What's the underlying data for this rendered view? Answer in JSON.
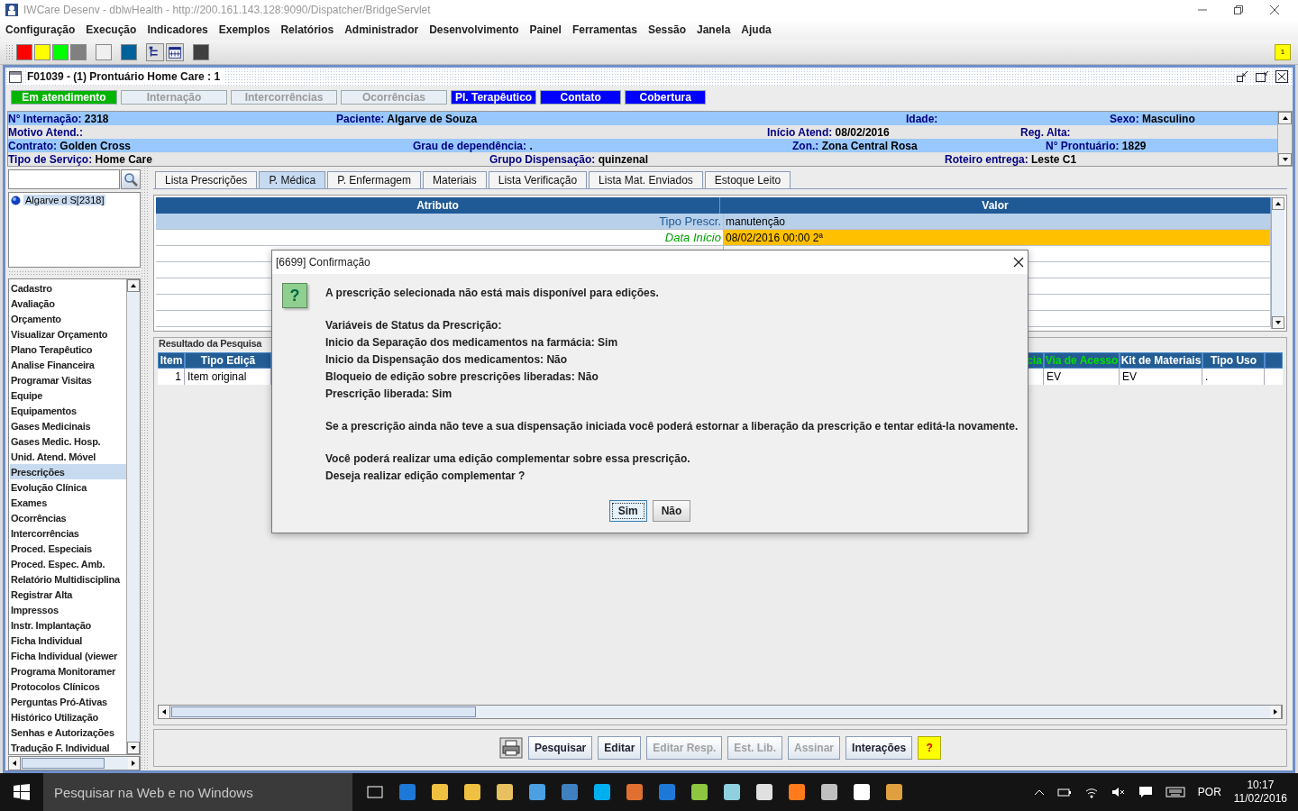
{
  "window": {
    "title": "IWCare Desenv - dblwHealth - http://200.161.143.128:9090/Dispatcher/BridgeServlet"
  },
  "menu": [
    "Configuração",
    "Execução",
    "Indicadores",
    "Exemplos",
    "Relatórios",
    "Administrador",
    "Desenvolvimento",
    "Painel",
    "Ferramentas",
    "Sessão",
    "Janela",
    "Ajuda"
  ],
  "toolbar": {
    "items": [
      {
        "kind": "swatch",
        "color": "#ff0000"
      },
      {
        "kind": "swatch",
        "color": "#ffff00"
      },
      {
        "kind": "swatch",
        "color": "#00ff00"
      },
      {
        "kind": "swatch",
        "color": "#808080"
      },
      {
        "kind": "swatch",
        "color": "#f0f0f0"
      },
      {
        "kind": "swatch",
        "color": "#00629b"
      },
      {
        "kind": "tree"
      },
      {
        "kind": "calendar"
      },
      {
        "kind": "swatch",
        "color": "#404040"
      }
    ],
    "badge": "1"
  },
  "frame": {
    "title": "F01039 - (1) Prontuário Home Care : 1"
  },
  "status_tabs": [
    {
      "label": "Em atendimento",
      "color": "#00b400",
      "disabled": false
    },
    {
      "label": "Internação",
      "color": "#e8eef6",
      "disabled": true
    },
    {
      "label": "Intercorrências",
      "color": "#e8eef6",
      "disabled": true
    },
    {
      "label": "Ocorrências",
      "color": "#e8eef6",
      "disabled": true
    },
    {
      "label": "Pl. Terapêutico",
      "color": "#0000ff",
      "disabled": false
    },
    {
      "label": "Contato",
      "color": "#0000ff",
      "disabled": false
    },
    {
      "label": "Cobertura",
      "color": "#0000ff",
      "disabled": false
    }
  ],
  "patient_info": [
    {
      "fields": [
        {
          "label": "N° Internação:",
          "value": "2318"
        },
        {
          "label": "Paciente:",
          "value": "Algarve de Souza"
        },
        {
          "label": "Idade:"
        },
        {
          "label": "Sexo:",
          "value": "Masculino"
        }
      ]
    },
    {
      "fields": [
        {
          "label": "Motivo Atend.:"
        },
        {
          "label": "Início Atend:",
          "value": "08/02/2016"
        },
        {
          "label": "Reg. Alta:"
        }
      ]
    },
    {
      "fields": [
        {
          "label": "Contrato:",
          "value": "Golden Cross"
        },
        {
          "label": "Grau de dependência:",
          "value": "."
        },
        {
          "label": "Zon.:",
          "value": "Zona Central Rosa"
        },
        {
          "label": "N° Prontuário:",
          "value": "1829"
        }
      ]
    },
    {
      "fields": [
        {
          "label": "Tipo de Serviço:",
          "value": "Home Care"
        },
        {
          "label": "Grupo Dispensação:",
          "value": "quinzenal"
        },
        {
          "label": "Roteiro entrega:",
          "value": "Leste C1"
        }
      ]
    }
  ],
  "sidebar": {
    "tree": [
      {
        "label": "Algarve d S[2318]",
        "selected": true
      }
    ],
    "items": [
      {
        "label": "Cadastro",
        "selected": false
      },
      {
        "label": "Avaliação",
        "selected": false
      },
      {
        "label": "Orçamento",
        "selected": false
      },
      {
        "label": "Visualizar Orçamento",
        "selected": false
      },
      {
        "label": "Plano Terapêutico",
        "selected": false
      },
      {
        "label": "Analise Financeira",
        "selected": false
      },
      {
        "label": "Programar Visitas",
        "selected": false
      },
      {
        "label": "Equipe",
        "selected": false
      },
      {
        "label": "Equipamentos",
        "selected": false
      },
      {
        "label": "Gases Medicinais",
        "selected": false
      },
      {
        "label": "Gases Medic. Hosp.",
        "selected": false
      },
      {
        "label": "Unid. Atend. Móvel",
        "selected": false
      },
      {
        "label": "Prescrições",
        "selected": true
      },
      {
        "label": "Evolução Clínica",
        "selected": false
      },
      {
        "label": "Exames",
        "selected": false
      },
      {
        "label": "Ocorrências",
        "selected": false
      },
      {
        "label": "Intercorrências",
        "selected": false
      },
      {
        "label": "Proced. Especiais",
        "selected": false
      },
      {
        "label": "Proced. Espec. Amb.",
        "selected": false
      },
      {
        "label": "Relatório Multidisciplina",
        "selected": false
      },
      {
        "label": "Registrar Alta",
        "selected": false
      },
      {
        "label": "Impressos",
        "selected": false
      },
      {
        "label": "Instr. Implantação",
        "selected": false
      },
      {
        "label": "Ficha Individual",
        "selected": false
      },
      {
        "label": "Ficha Individual (viewer",
        "selected": false
      },
      {
        "label": "Programa Monitoramer",
        "selected": false
      },
      {
        "label": "Protocolos Clínicos",
        "selected": false
      },
      {
        "label": "Perguntas Pró-Ativas",
        "selected": false
      },
      {
        "label": "Histórico Utilização",
        "selected": false
      },
      {
        "label": "Senhas e Autorizações",
        "selected": false
      },
      {
        "label": "Tradução F. Individual",
        "selected": false
      }
    ]
  },
  "tabs": [
    {
      "label": "Lista Prescrições",
      "selected": false
    },
    {
      "label": "P. Médica",
      "selected": true
    },
    {
      "label": "P. Enfermagem",
      "selected": false
    },
    {
      "label": "Materiais",
      "selected": false
    },
    {
      "label": "Lista Verificação",
      "selected": false
    },
    {
      "label": "Lista Mat. Enviados",
      "selected": false
    },
    {
      "label": "Estoque Leito",
      "selected": false
    }
  ],
  "attributes": {
    "columns": [
      "Atributo",
      "Valor"
    ],
    "rows": [
      {
        "kind": "info",
        "attribute": "Tipo Prescr.",
        "value": "manutenção"
      },
      {
        "kind": "alert",
        "attribute": "Data Início",
        "value": "08/02/2016 00:00 2ª"
      }
    ]
  },
  "results": {
    "title": "Resultado da Pesquisa",
    "columns": [
      {
        "label": "Item",
        "highlighted": false
      },
      {
        "label": "Tipo Ediçã",
        "highlighted": false
      },
      {
        "label": "cia",
        "highlighted": true
      },
      {
        "label": "Via de Acesso",
        "highlighted": true
      },
      {
        "label": "Kit de Materiais",
        "highlighted": false
      },
      {
        "label": "Tipo Uso",
        "highlighted": false
      }
    ],
    "rows": [
      [
        "1",
        "Item original",
        null,
        "EV",
        "EV",
        "."
      ]
    ]
  },
  "actions": [
    {
      "kind": "print"
    },
    {
      "kind": "button",
      "label": "Pesquisar",
      "disabled": false
    },
    {
      "kind": "button",
      "label": "Editar",
      "disabled": false
    },
    {
      "kind": "button",
      "label": "Editar Resp.",
      "disabled": true
    },
    {
      "kind": "button",
      "label": "Est. Lib.",
      "disabled": true
    },
    {
      "kind": "button",
      "label": "Assinar",
      "disabled": true
    },
    {
      "kind": "button",
      "label": "Interações",
      "disabled": false
    },
    {
      "kind": "help",
      "label": "?"
    }
  ],
  "dialog": {
    "title": "[6699] Confirmação",
    "icon": "?",
    "paragraphs": [
      [
        "A prescrição selecionada não está mais disponível para edições."
      ],
      [
        "Variáveis de Status da Prescrição:",
        "Inicio da Separação dos medicamentos na farmácia: Sim",
        "Inicio da Dispensação dos medicamentos: Não",
        "Bloqueio de edição sobre prescrições liberadas: Não",
        "Prescrição liberada: Sim"
      ],
      [
        "Se a prescrição ainda não teve a sua dispensação iniciada você poderá estornar a liberação da prescrição e tentar editá-la novamente."
      ],
      [
        "Você poderá realizar uma edição complementar sobre essa prescrição.",
        "Deseja realizar edição complementar ?"
      ]
    ],
    "buttons": [
      {
        "label": "Sim",
        "selected": true
      },
      {
        "label": "Não",
        "selected": false
      }
    ]
  },
  "taskbar": {
    "placeholder": "Pesquisar na Web e no Windows",
    "language": "POR",
    "time": "10:17",
    "date": "11/02/2016"
  }
}
